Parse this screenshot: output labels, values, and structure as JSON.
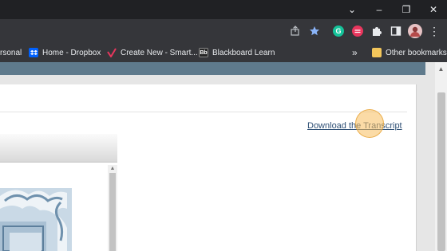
{
  "window": {
    "controls": [
      "chevron-down",
      "minimize",
      "restore",
      "close"
    ],
    "glyphs": {
      "chevron": "⌄",
      "minimize": "–",
      "restore": "❐",
      "close": "✕"
    }
  },
  "toolbar": {
    "icons": [
      "share-icon",
      "star-icon",
      "grammarly-icon",
      "extension-red-icon",
      "puzzle-icon",
      "side-panel-icon",
      "profile-avatar",
      "menu-icon"
    ],
    "grammarly_letter": "G",
    "menu_glyph": "⋮"
  },
  "bookmarks": {
    "items": [
      {
        "label": "rsonal"
      },
      {
        "label": "Home - Dropbox"
      },
      {
        "label": "Create New - Smart..."
      },
      {
        "label": "Blackboard Learn",
        "favicon_text": "Bb"
      }
    ],
    "overflow": "»",
    "other": "Other bookmarks"
  },
  "page": {
    "download_link": "Download the Transcript"
  },
  "colors": {
    "chrome_dark": "#202124",
    "toolbar": "#35363a",
    "page_header": "#5f7a8c",
    "link": "#2d4e74",
    "highlight": "#f7be5c"
  }
}
